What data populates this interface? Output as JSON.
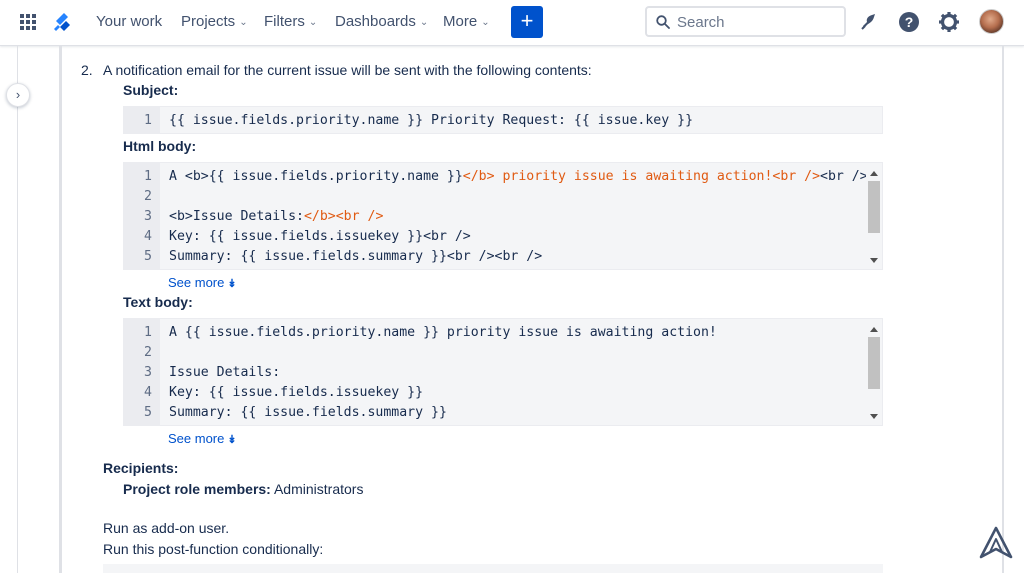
{
  "nav": {
    "items": [
      {
        "label": "Your work",
        "chevron": false
      },
      {
        "label": "Projects",
        "chevron": true
      },
      {
        "label": "Filters",
        "chevron": true
      },
      {
        "label": "Dashboards",
        "chevron": true
      },
      {
        "label": "More",
        "chevron": true
      }
    ],
    "create_label": "+",
    "search_placeholder": "Search",
    "icons": [
      "app-switcher-icon",
      "jira-logo",
      "notification-icon",
      "help-icon",
      "settings-icon",
      "avatar"
    ]
  },
  "step": {
    "number": "2.",
    "text": "A notification email for the current issue will be sent with the following contents:"
  },
  "subject": {
    "label": "Subject:",
    "lines": [
      {
        "n": "1",
        "text": "{{ issue.fields.priority.name }} Priority Request: {{ issue.key }}"
      }
    ]
  },
  "html_body": {
    "label": "Html body:",
    "lines": [
      {
        "n": "1",
        "a": "A <b>{{ issue.fields.priority.name }}",
        "b": "</b> priority issue is awaiting action!<br />",
        "c": "<br />"
      },
      {
        "n": "2",
        "a": "",
        "b": "",
        "c": ""
      },
      {
        "n": "3",
        "a": "<b>Issue Details:",
        "b": "</b><br />",
        "c": ""
      },
      {
        "n": "4",
        "a": "Key: {{ issue.fields.issuekey }}<br />",
        "b": "",
        "c": ""
      },
      {
        "n": "5",
        "a": "Summary: {{ issue.fields.summary }}<br /><br />",
        "b": "",
        "c": ""
      }
    ],
    "see_more": "See more",
    "see_more_icon": "double-chevron-down-icon"
  },
  "text_body": {
    "label": "Text body:",
    "lines": [
      {
        "n": "1",
        "text": "A {{ issue.fields.priority.name }} priority issue is awaiting action!"
      },
      {
        "n": "2",
        "text": ""
      },
      {
        "n": "3",
        "text": "Issue Details:"
      },
      {
        "n": "4",
        "text": "Key: {{ issue.fields.issuekey }}"
      },
      {
        "n": "5",
        "text": "Summary: {{ issue.fields.summary }}"
      }
    ],
    "see_more": "See more"
  },
  "recipients": {
    "label": "Recipients:",
    "role_label": "Project role members:",
    "role_value": "Administrators"
  },
  "run_as": "Run as add-on user.",
  "run_conditionally": "Run this post-function conditionally:",
  "colors": {
    "accent": "#0052cc",
    "tag_orange": "#e05a12",
    "text": "#172b4d",
    "code_bg": "#f4f5f7"
  }
}
